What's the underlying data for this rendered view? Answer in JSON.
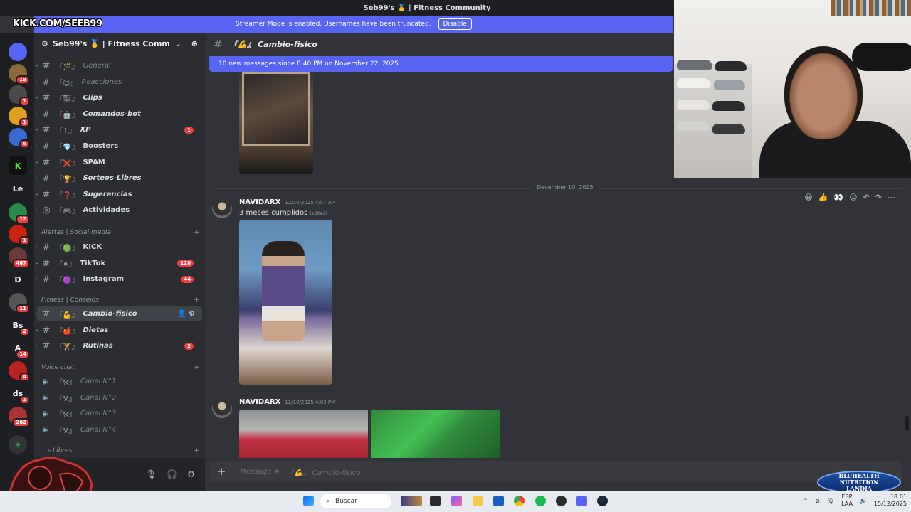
{
  "window": {
    "title": "Seb99's 🥇 | Fitness Community"
  },
  "overlay": {
    "kick_text": "KICK.COM/SEEB99"
  },
  "banner": {
    "text": "Streamer Mode is enabled. Usernames have been truncated.",
    "button": "Disable"
  },
  "server_rail": [
    {
      "icon": "discord-home-icon",
      "badge": ""
    },
    {
      "icon": "server-avatar",
      "badge": "19"
    },
    {
      "icon": "server-avatar",
      "badge": "1"
    },
    {
      "icon": "server-avatar",
      "badge": "1"
    },
    {
      "icon": "server-avatar",
      "badge": "6"
    },
    {
      "icon": "kick-server-icon",
      "badge": ""
    },
    {
      "text": "Le",
      "badge": ""
    },
    {
      "icon": "server-avatar",
      "badge": "12"
    },
    {
      "icon": "server-avatar",
      "badge": "1"
    },
    {
      "icon": "server-avatar",
      "badge": "467"
    },
    {
      "text": "D",
      "badge": ""
    },
    {
      "icon": "server-avatar",
      "badge": "11"
    },
    {
      "text": "Bs",
      "badge": "2"
    },
    {
      "text": "A",
      "badge": "14"
    },
    {
      "icon": "server-avatar",
      "badge": "4"
    },
    {
      "text": "ds",
      "badge": "1"
    },
    {
      "icon": "server-avatar",
      "badge": "202"
    }
  ],
  "server": {
    "name": "Seb99's 🥇 | Fitness Comm..."
  },
  "channels": [
    {
      "emoji": "『🪄』",
      "name": "General",
      "style": "muted",
      "count": ""
    },
    {
      "emoji": "『😊』",
      "name": "Reacciones",
      "style": "muted",
      "count": ""
    },
    {
      "emoji": "『🎬』",
      "name": "Clips",
      "style": "ital",
      "count": ""
    },
    {
      "emoji": "『🤖』",
      "name": "Comandos-bot",
      "style": "ital",
      "count": ""
    },
    {
      "emoji": "『↑』",
      "name": "XP",
      "style": "ital",
      "count": "1"
    },
    {
      "emoji": "『💎』",
      "name": "Boosters",
      "style": "",
      "count": ""
    },
    {
      "emoji": "『❌』",
      "name": "SPAM",
      "style": "",
      "count": ""
    },
    {
      "emoji": "『🏆』",
      "name": "Sorteos-Libres",
      "style": "ital",
      "count": ""
    },
    {
      "emoji": "『❓』",
      "name": "Sugerencias",
      "style": "ital",
      "count": ""
    },
    {
      "emoji": "『🎮』",
      "name": "Actividades",
      "style": "plain",
      "count": ""
    }
  ],
  "category_alerts": "Alertas | Social media",
  "alerts": [
    {
      "emoji": "『🟢』",
      "name": "KICK",
      "count": ""
    },
    {
      "emoji": "『⚫』",
      "name": "TikTok",
      "count": "120"
    },
    {
      "emoji": "『🟣』",
      "name": "Instagram",
      "count": "44"
    }
  ],
  "category_fitness": "Fitness | Consejos",
  "fitness": [
    {
      "emoji": "『💪』",
      "name": "Cambio-fisico",
      "count": "",
      "active": true
    },
    {
      "emoji": "『🍎』",
      "name": "Dietas",
      "count": ""
    },
    {
      "emoji": "『🏋』",
      "name": "Rutinas",
      "count": "2"
    }
  ],
  "category_voice": "Voice chat",
  "voice": [
    {
      "name": "Canal N°1"
    },
    {
      "name": "Canal N°2"
    },
    {
      "name": "Canal N°3"
    },
    {
      "name": "Canal N°4"
    }
  ],
  "category_libres": "...s Libres",
  "chat": {
    "channel": "『💪』 Cambio-fisico",
    "new_messages": "10 new messages since 8:40 PM on November 22, 2025",
    "date_divider": "December 10, 2025",
    "messages": [
      {
        "author": "NAVIDARX",
        "time": "12/10/2025 4:57 AM",
        "text": "3 meses cumplidos",
        "edited": "(edited)"
      },
      {
        "author": "NAVIDARX",
        "time": "12/10/2025 4:03 PM",
        "text": "",
        "edited": ""
      }
    ],
    "composer_placeholder": "Message #",
    "composer_channel": "『💪』 Cambio-fisico"
  },
  "taskbar": {
    "search": "Buscar",
    "lang_top": "ESP",
    "lang_bottom": "LAA",
    "time": "18:01",
    "date": "15/12/2025"
  },
  "sponsor": {
    "line1": "BLUHEALTH",
    "line2": "NUTRITION",
    "line3": "LANDIA"
  },
  "colors": {
    "blurple": "#5865f2",
    "badge_red": "#f23f43",
    "bg": "#313338",
    "sidebar": "#2b2d31",
    "rail": "#1e1f22"
  }
}
